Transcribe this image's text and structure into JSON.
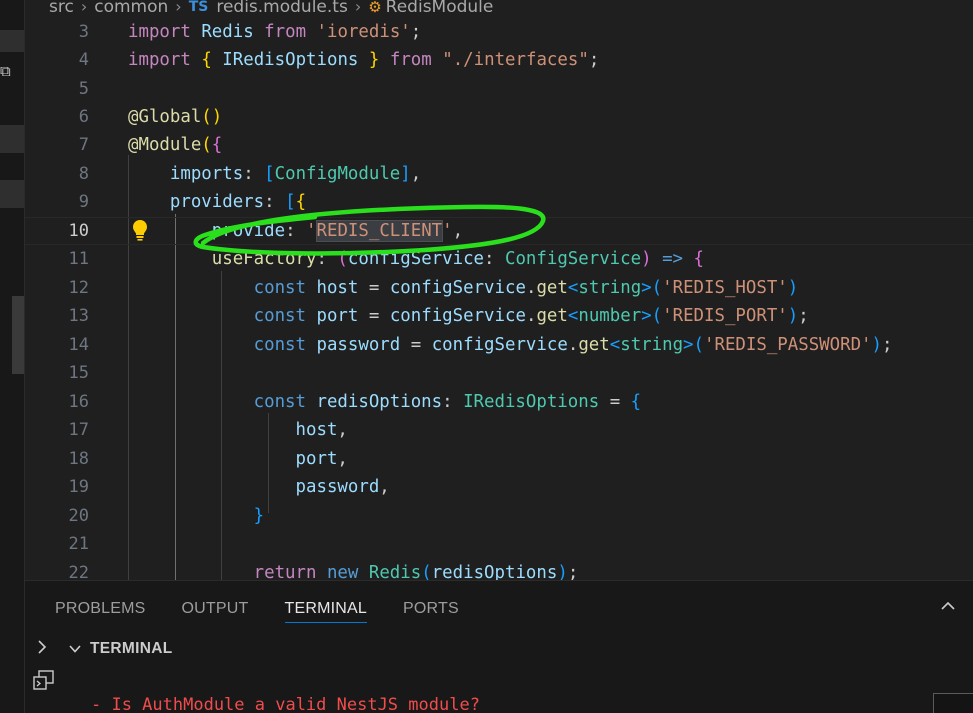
{
  "breadcrumb": {
    "items": [
      "src",
      "common",
      "redis.module.ts",
      "RedisModule"
    ],
    "file_badge": "TS"
  },
  "editor": {
    "active_line": 10,
    "lines": [
      {
        "n": "3"
      },
      {
        "n": "4"
      },
      {
        "n": "5"
      },
      {
        "n": "6"
      },
      {
        "n": "7"
      },
      {
        "n": "8"
      },
      {
        "n": "9"
      },
      {
        "n": "10"
      },
      {
        "n": "11"
      },
      {
        "n": "12"
      },
      {
        "n": "13"
      },
      {
        "n": "14"
      },
      {
        "n": "15"
      },
      {
        "n": "16"
      },
      {
        "n": "17"
      },
      {
        "n": "18"
      },
      {
        "n": "19"
      },
      {
        "n": "20"
      },
      {
        "n": "21"
      },
      {
        "n": "22"
      }
    ],
    "tokens": {
      "import": "import",
      "from": "from",
      "redis": "Redis",
      "ioredis": "'ioredis'",
      "iopts": "IRedisOptions",
      "interfaces": "\"./interfaces\"",
      "global": "@Global",
      "module": "@Module",
      "imports": "imports",
      "configmodule": "ConfigModule",
      "providers": "providers",
      "provide": "provide",
      "redis_client": "REDIS_CLIENT",
      "usefactory": "useFactory",
      "configservice_var": "configService",
      "configservice_type": "ConfigService",
      "const": "const",
      "host": "host",
      "port": "port",
      "password": "password",
      "get": "get",
      "string": "string",
      "number": "number",
      "redis_host": "'REDIS_HOST'",
      "redis_port": "'REDIS_PORT'",
      "redis_password": "'REDIS_PASSWORD'",
      "redisoptions": "redisOptions",
      "return": "return",
      "new": "new"
    }
  },
  "panel": {
    "tabs": [
      "PROBLEMS",
      "OUTPUT",
      "TERMINAL",
      "PORTS"
    ],
    "active_tab": "TERMINAL",
    "section_title": "TERMINAL",
    "terminal_line": "- Is AuthModule a valid NestJS module?"
  },
  "colors": {
    "keyword": "#569cd6",
    "string": "#ce9178",
    "type": "#4ec9b0",
    "variable": "#9cdcfe",
    "error": "#f14c4c",
    "annotation": "#2adf1c"
  },
  "icons": [
    "chevron-right-icon",
    "lightbulb-icon",
    "chevron-up-icon",
    "chevron-down-icon",
    "terminal-icon",
    "symbol-class-icon"
  ]
}
